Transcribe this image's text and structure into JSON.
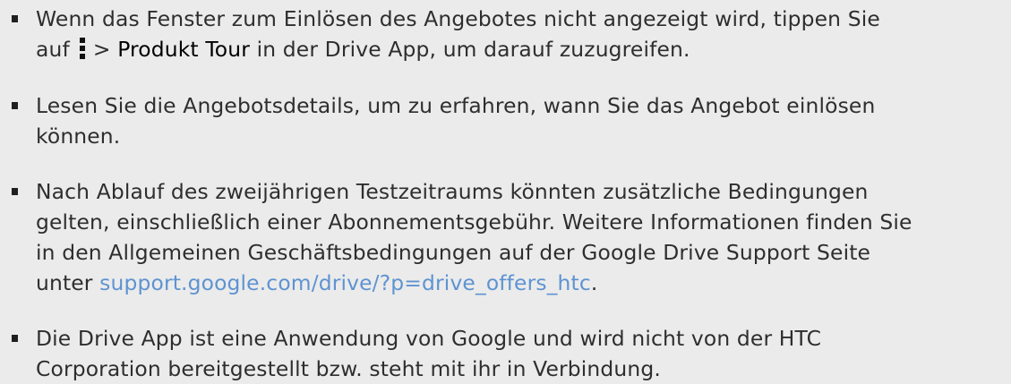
{
  "colors": {
    "background": "#ebebeb",
    "text": "#2e2e2e",
    "link": "#5e93d1"
  },
  "notes": [
    {
      "line1": "Wenn das Fenster zum Einlösen des Angebotes nicht angezeigt wird, tippen Sie",
      "line2_before": "auf",
      "line2_icon": "overflow-menu-icon",
      "line2_sep": ">",
      "line2_emph": "Produkt Tour",
      "line2_after": "in der Drive App, um darauf zuzugreifen."
    },
    {
      "line1": "Lesen Sie die Angebotsdetails, um zu erfahren, wann Sie das Angebot einlösen",
      "line2": "können."
    },
    {
      "line1": "Nach Ablauf des zweijährigen Testzeitraums könnten zusätzliche Bedingungen",
      "line2": "gelten, einschließlich einer Abonnementsgebühr. Weitere Informationen finden Sie",
      "line3": "in den Allgemeinen Geschäftsbedingungen auf der Google Drive Support Seite",
      "line4_before": "unter",
      "line4_link": "support.google.com/drive/?p=drive_offers_htc",
      "line4_after": "."
    },
    {
      "line1": "Die Drive App ist eine Anwendung von Google und wird nicht von der HTC",
      "line2": "Corporation bereitgestellt bzw. steht mit ihr in Verbindung."
    }
  ]
}
